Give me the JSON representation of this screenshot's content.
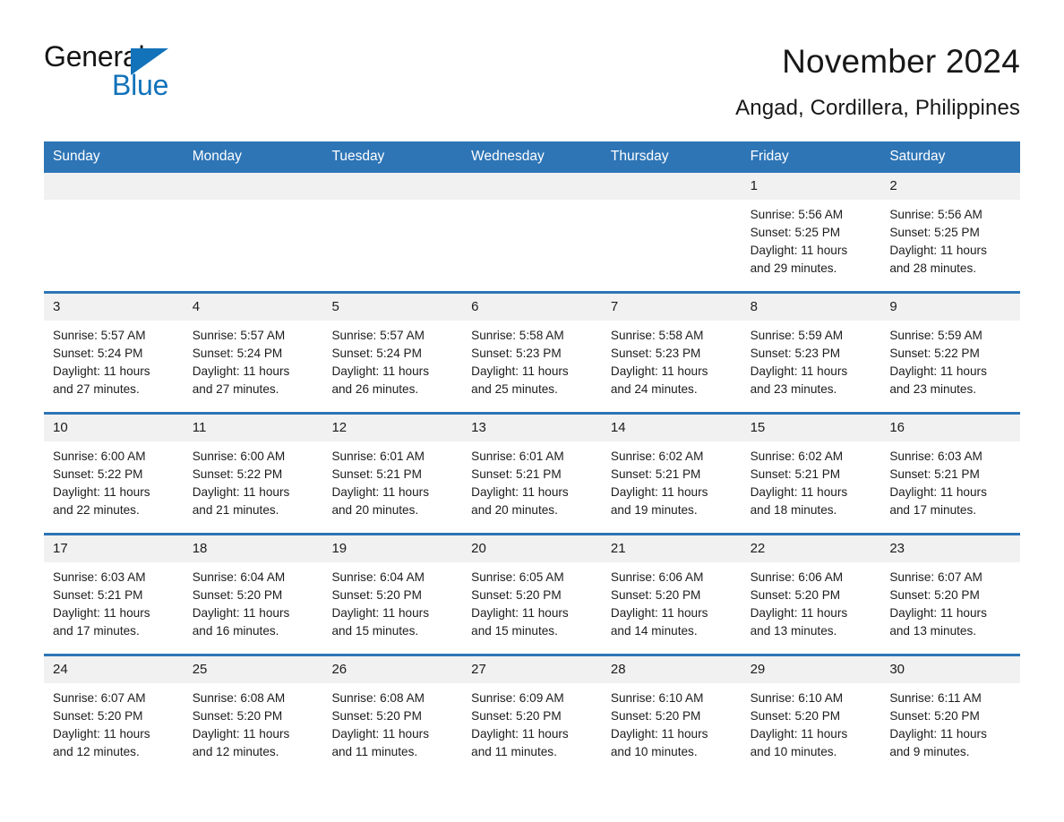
{
  "brand": {
    "name_part1": "General",
    "name_part2": "Blue",
    "triangle_icon": "triangle-icon",
    "accent_color": "#1272BA"
  },
  "header": {
    "title": "November 2024",
    "subtitle": "Angad, Cordillera, Philippines"
  },
  "theme": {
    "header_blue": "#2E75B6",
    "date_band_gray": "#F1F1F1",
    "text_color": "#1c1c1c"
  },
  "calendar": {
    "weekdays": [
      "Sunday",
      "Monday",
      "Tuesday",
      "Wednesday",
      "Thursday",
      "Friday",
      "Saturday"
    ],
    "weeks": [
      [
        {
          "day": "",
          "empty": true
        },
        {
          "day": "",
          "empty": true
        },
        {
          "day": "",
          "empty": true
        },
        {
          "day": "",
          "empty": true
        },
        {
          "day": "",
          "empty": true
        },
        {
          "day": "1",
          "sunrise": "Sunrise: 5:56 AM",
          "sunset": "Sunset: 5:25 PM",
          "daylight": "Daylight: 11 hours and 29 minutes."
        },
        {
          "day": "2",
          "sunrise": "Sunrise: 5:56 AM",
          "sunset": "Sunset: 5:25 PM",
          "daylight": "Daylight: 11 hours and 28 minutes."
        }
      ],
      [
        {
          "day": "3",
          "sunrise": "Sunrise: 5:57 AM",
          "sunset": "Sunset: 5:24 PM",
          "daylight": "Daylight: 11 hours and 27 minutes."
        },
        {
          "day": "4",
          "sunrise": "Sunrise: 5:57 AM",
          "sunset": "Sunset: 5:24 PM",
          "daylight": "Daylight: 11 hours and 27 minutes."
        },
        {
          "day": "5",
          "sunrise": "Sunrise: 5:57 AM",
          "sunset": "Sunset: 5:24 PM",
          "daylight": "Daylight: 11 hours and 26 minutes."
        },
        {
          "day": "6",
          "sunrise": "Sunrise: 5:58 AM",
          "sunset": "Sunset: 5:23 PM",
          "daylight": "Daylight: 11 hours and 25 minutes."
        },
        {
          "day": "7",
          "sunrise": "Sunrise: 5:58 AM",
          "sunset": "Sunset: 5:23 PM",
          "daylight": "Daylight: 11 hours and 24 minutes."
        },
        {
          "day": "8",
          "sunrise": "Sunrise: 5:59 AM",
          "sunset": "Sunset: 5:23 PM",
          "daylight": "Daylight: 11 hours and 23 minutes."
        },
        {
          "day": "9",
          "sunrise": "Sunrise: 5:59 AM",
          "sunset": "Sunset: 5:22 PM",
          "daylight": "Daylight: 11 hours and 23 minutes."
        }
      ],
      [
        {
          "day": "10",
          "sunrise": "Sunrise: 6:00 AM",
          "sunset": "Sunset: 5:22 PM",
          "daylight": "Daylight: 11 hours and 22 minutes."
        },
        {
          "day": "11",
          "sunrise": "Sunrise: 6:00 AM",
          "sunset": "Sunset: 5:22 PM",
          "daylight": "Daylight: 11 hours and 21 minutes."
        },
        {
          "day": "12",
          "sunrise": "Sunrise: 6:01 AM",
          "sunset": "Sunset: 5:21 PM",
          "daylight": "Daylight: 11 hours and 20 minutes."
        },
        {
          "day": "13",
          "sunrise": "Sunrise: 6:01 AM",
          "sunset": "Sunset: 5:21 PM",
          "daylight": "Daylight: 11 hours and 20 minutes."
        },
        {
          "day": "14",
          "sunrise": "Sunrise: 6:02 AM",
          "sunset": "Sunset: 5:21 PM",
          "daylight": "Daylight: 11 hours and 19 minutes."
        },
        {
          "day": "15",
          "sunrise": "Sunrise: 6:02 AM",
          "sunset": "Sunset: 5:21 PM",
          "daylight": "Daylight: 11 hours and 18 minutes."
        },
        {
          "day": "16",
          "sunrise": "Sunrise: 6:03 AM",
          "sunset": "Sunset: 5:21 PM",
          "daylight": "Daylight: 11 hours and 17 minutes."
        }
      ],
      [
        {
          "day": "17",
          "sunrise": "Sunrise: 6:03 AM",
          "sunset": "Sunset: 5:21 PM",
          "daylight": "Daylight: 11 hours and 17 minutes."
        },
        {
          "day": "18",
          "sunrise": "Sunrise: 6:04 AM",
          "sunset": "Sunset: 5:20 PM",
          "daylight": "Daylight: 11 hours and 16 minutes."
        },
        {
          "day": "19",
          "sunrise": "Sunrise: 6:04 AM",
          "sunset": "Sunset: 5:20 PM",
          "daylight": "Daylight: 11 hours and 15 minutes."
        },
        {
          "day": "20",
          "sunrise": "Sunrise: 6:05 AM",
          "sunset": "Sunset: 5:20 PM",
          "daylight": "Daylight: 11 hours and 15 minutes."
        },
        {
          "day": "21",
          "sunrise": "Sunrise: 6:06 AM",
          "sunset": "Sunset: 5:20 PM",
          "daylight": "Daylight: 11 hours and 14 minutes."
        },
        {
          "day": "22",
          "sunrise": "Sunrise: 6:06 AM",
          "sunset": "Sunset: 5:20 PM",
          "daylight": "Daylight: 11 hours and 13 minutes."
        },
        {
          "day": "23",
          "sunrise": "Sunrise: 6:07 AM",
          "sunset": "Sunset: 5:20 PM",
          "daylight": "Daylight: 11 hours and 13 minutes."
        }
      ],
      [
        {
          "day": "24",
          "sunrise": "Sunrise: 6:07 AM",
          "sunset": "Sunset: 5:20 PM",
          "daylight": "Daylight: 11 hours and 12 minutes."
        },
        {
          "day": "25",
          "sunrise": "Sunrise: 6:08 AM",
          "sunset": "Sunset: 5:20 PM",
          "daylight": "Daylight: 11 hours and 12 minutes."
        },
        {
          "day": "26",
          "sunrise": "Sunrise: 6:08 AM",
          "sunset": "Sunset: 5:20 PM",
          "daylight": "Daylight: 11 hours and 11 minutes."
        },
        {
          "day": "27",
          "sunrise": "Sunrise: 6:09 AM",
          "sunset": "Sunset: 5:20 PM",
          "daylight": "Daylight: 11 hours and 11 minutes."
        },
        {
          "day": "28",
          "sunrise": "Sunrise: 6:10 AM",
          "sunset": "Sunset: 5:20 PM",
          "daylight": "Daylight: 11 hours and 10 minutes."
        },
        {
          "day": "29",
          "sunrise": "Sunrise: 6:10 AM",
          "sunset": "Sunset: 5:20 PM",
          "daylight": "Daylight: 11 hours and 10 minutes."
        },
        {
          "day": "30",
          "sunrise": "Sunrise: 6:11 AM",
          "sunset": "Sunset: 5:20 PM",
          "daylight": "Daylight: 11 hours and 9 minutes."
        }
      ]
    ]
  }
}
